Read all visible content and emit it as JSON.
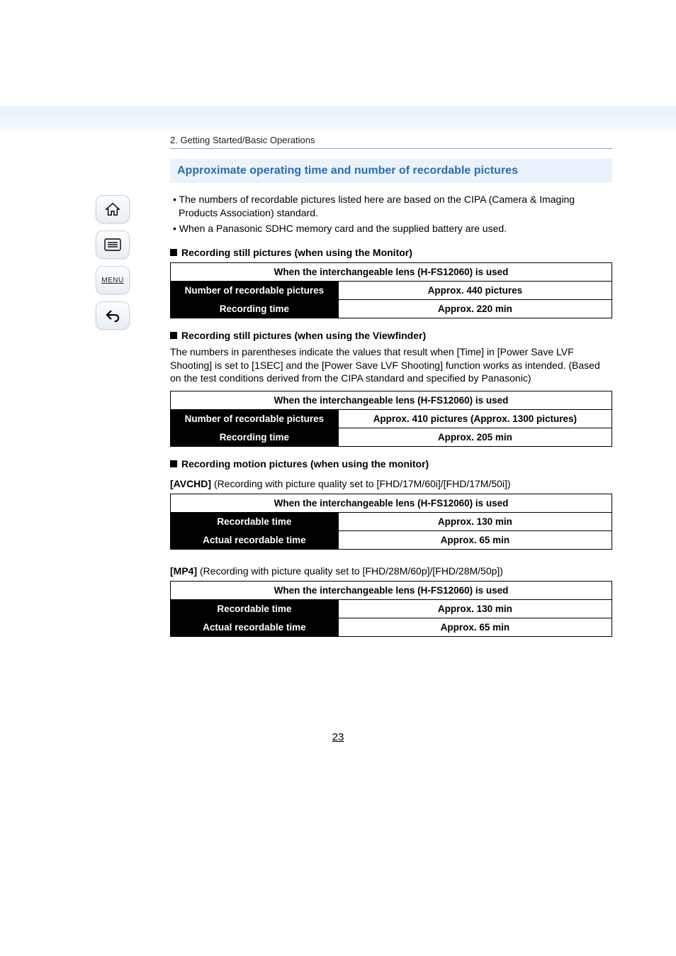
{
  "breadcrumb": "2. Getting Started/Basic Operations",
  "section_title": "Approximate operating time and number of recordable pictures",
  "intro_bullets": [
    "• The numbers of recordable pictures listed here are based on the CIPA (Camera & Imaging Products Association) standard.",
    "• When a Panasonic SDHC memory card and the supplied battery are used."
  ],
  "block1": {
    "heading": "Recording still pictures (when using the Monitor)",
    "table_title": "When the interchangeable lens (H-FS12060) is used",
    "rows": [
      {
        "label": "Number of recordable pictures",
        "value": "Approx. 440 pictures"
      },
      {
        "label": "Recording time",
        "value": "Approx. 220 min"
      }
    ]
  },
  "block2": {
    "heading": "Recording still pictures (when using the Viewfinder)",
    "note": "The numbers in parentheses indicate the values that result when [Time] in [Power Save LVF Shooting] is set to [1SEC] and the [Power Save LVF Shooting] function works as intended. (Based on the test conditions derived from the CIPA standard and specified by Panasonic)",
    "table_title": "When the interchangeable lens (H-FS12060) is used",
    "rows": [
      {
        "label": "Number of recordable pictures",
        "value": "Approx. 410 pictures (Approx. 1300 pictures)"
      },
      {
        "label": "Recording time",
        "value": "Approx. 205 min"
      }
    ]
  },
  "block3": {
    "heading": "Recording motion pictures (when using the monitor)",
    "mode_label": "[AVCHD]",
    "mode_desc": " (Recording with picture quality set to [FHD/17M/60i]/[FHD/17M/50i])",
    "table_title": "When the interchangeable lens (H-FS12060) is used",
    "rows": [
      {
        "label": "Recordable time",
        "value": "Approx. 130 min"
      },
      {
        "label": "Actual recordable time",
        "value": "Approx. 65 min"
      }
    ]
  },
  "block4": {
    "mode_label": "[MP4]",
    "mode_desc": " (Recording with picture quality set to [FHD/28M/60p]/[FHD/28M/50p])",
    "table_title": "When the interchangeable lens (H-FS12060) is used",
    "rows": [
      {
        "label": "Recordable time",
        "value": "Approx. 130 min"
      },
      {
        "label": "Actual recordable time",
        "value": "Approx. 65 min"
      }
    ]
  },
  "page_number": "23",
  "sidebar": {
    "menu_label": "MENU"
  }
}
